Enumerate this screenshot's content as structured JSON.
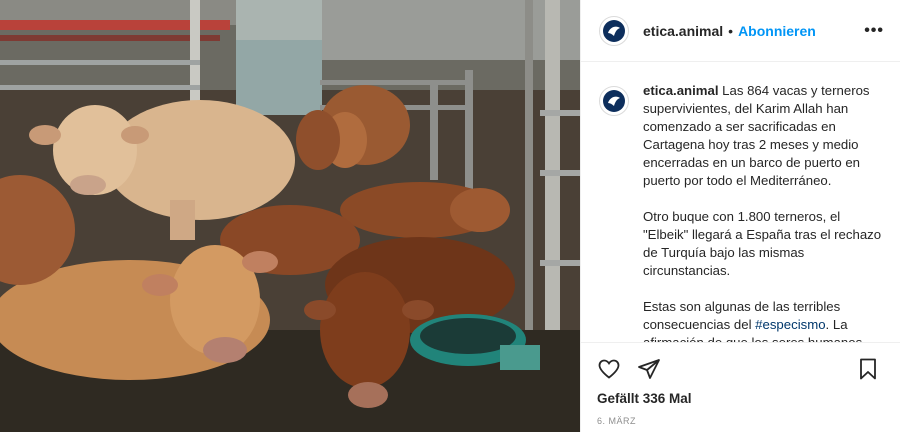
{
  "account": {
    "username": "etica.animal",
    "follow_label": "Abonnieren",
    "separator": "•",
    "more_label": "•••"
  },
  "caption": {
    "username": "etica.animal",
    "paragraph1": "Las 864 vacas y terneros supervivientes, del Karim Allah han comenzado a ser sacrificadas en Cartagena hoy tras 2 meses y medio encerradas en un barco de puerto en puerto por todo el Mediterráneo.",
    "paragraph2": "Otro buque con 1.800 terneros, el \"Elbeik\" llegará a España tras el rechazo de Turquía bajo las mismas circunstancias.",
    "paragraph3_prefix": "Estas son algunas de las terribles consecuencias del ",
    "paragraph3_hashtag": "#especismo",
    "paragraph3_suffix": ". La afirmación de que los seres humanos"
  },
  "actions": {
    "icons": [
      "heart-icon",
      "share-icon",
      "bookmark-icon"
    ],
    "likes": "Gefällt 336 Mal",
    "date": "6. März"
  },
  "colors": {
    "accent": "#0095f6",
    "hashtag": "#00376b",
    "text": "#262626",
    "muted": "#8e8e8e"
  }
}
